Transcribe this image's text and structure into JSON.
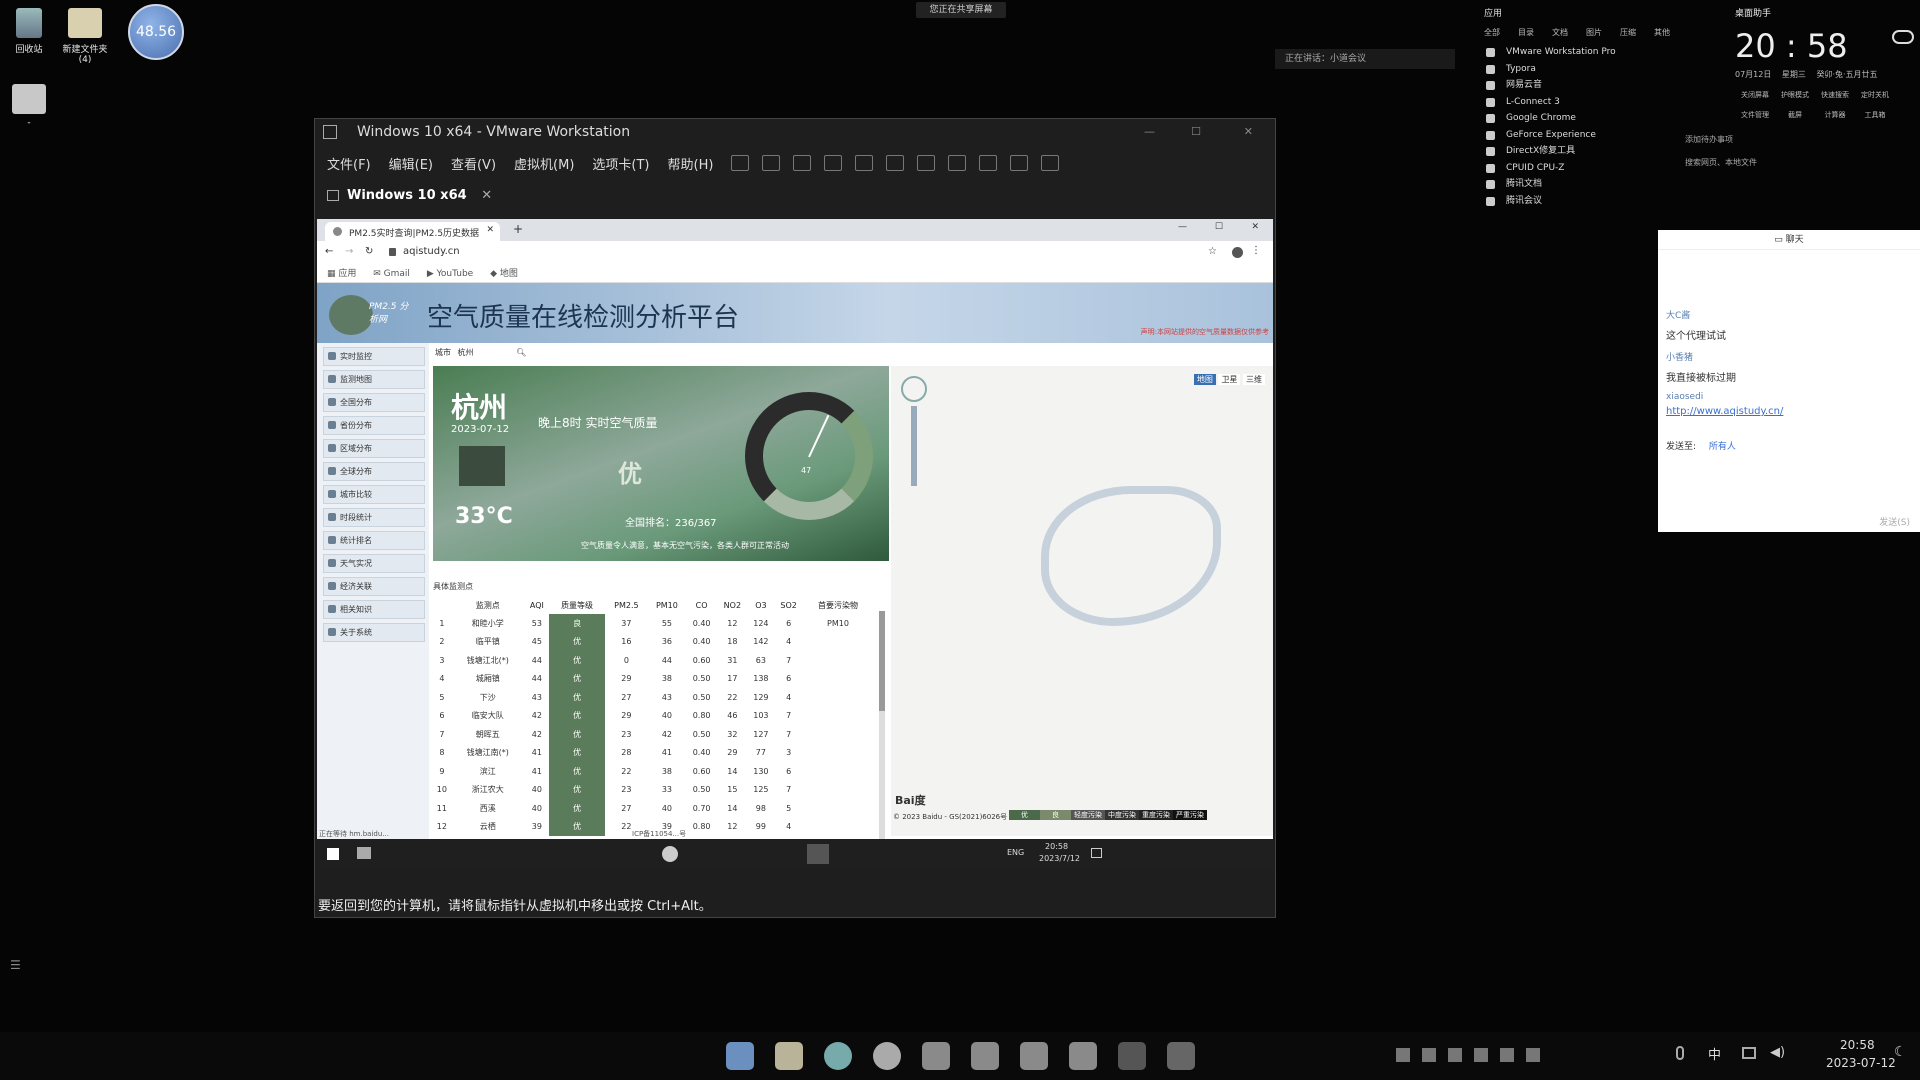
{
  "desktop": {
    "recycle_bin_label": "回收站",
    "new_folder_label": "新建文件夹",
    "new_folder_sub": "(4)",
    "folder2_label": "-",
    "clock_widget_value": "48.56",
    "share_banner": "您正在共享屏幕",
    "speaking_banner": "正在讲话：小道会议"
  },
  "vmware": {
    "title": "Windows 10 x64 - VMware Workstation",
    "menu": [
      "文件(F)",
      "编辑(E)",
      "查看(V)",
      "虚拟机(M)",
      "选项卡(T)",
      "帮助(H)"
    ],
    "tab_label": "Windows 10 x64",
    "status_text": "要返回到您的计算机，请将鼠标指针从虚拟机中移出或按 Ctrl+Alt。"
  },
  "browser": {
    "tab_title": "PM2.5实时查询|PM2.5历史数据",
    "url": "aqistudy.cn",
    "bookmarks": [
      "应用",
      "Gmail",
      "YouTube",
      "地图"
    ]
  },
  "site": {
    "logo_text": "PM2.5 分析网",
    "title": "空气质量在线检测分析平台",
    "header_right": "声明:本网站提供的空气质量数据仅供参考",
    "city_label": "城市",
    "city_value": "杭州",
    "sidebar": [
      "实时监控",
      "监测地图",
      "全国分布",
      "省份分布",
      "区域分布",
      "全球分布",
      "城市比较",
      "时段统计",
      "统计排名",
      "天气实况",
      "经济关联",
      "相关知识",
      "关于系统"
    ],
    "weather": {
      "city": "杭州",
      "date": "2023-07-12",
      "temp": "33°C",
      "heading": "晚上8时 实时空气质量",
      "quality": "优",
      "rank_text": "全国排名：236/367",
      "advice": "空气质量令人满意，基本无空气污染，各类人群可正常活动",
      "gauge_value": "47"
    },
    "table_title": "具体监测点",
    "table_headers": [
      "",
      "监测点",
      "AQI",
      "质量等级",
      "PM2.5",
      "PM10",
      "CO",
      "NO2",
      "O3",
      "SO2",
      "首要污染物"
    ],
    "table_rows": [
      [
        "1",
        "和睦小学",
        "53",
        "良",
        "37",
        "55",
        "0.40",
        "12",
        "124",
        "6",
        "PM10"
      ],
      [
        "2",
        "临平镇",
        "45",
        "优",
        "16",
        "36",
        "0.40",
        "18",
        "142",
        "4",
        ""
      ],
      [
        "3",
        "钱塘江北(*)",
        "44",
        "优",
        "0",
        "44",
        "0.60",
        "31",
        "63",
        "7",
        ""
      ],
      [
        "4",
        "城厢镇",
        "44",
        "优",
        "29",
        "38",
        "0.50",
        "17",
        "138",
        "6",
        ""
      ],
      [
        "5",
        "下沙",
        "43",
        "优",
        "27",
        "43",
        "0.50",
        "22",
        "129",
        "4",
        ""
      ],
      [
        "6",
        "临安大队",
        "42",
        "优",
        "29",
        "40",
        "0.80",
        "46",
        "103",
        "7",
        ""
      ],
      [
        "7",
        "朝晖五",
        "42",
        "优",
        "23",
        "42",
        "0.50",
        "32",
        "127",
        "7",
        ""
      ],
      [
        "8",
        "钱塘江南(*)",
        "41",
        "优",
        "28",
        "41",
        "0.40",
        "29",
        "77",
        "3",
        ""
      ],
      [
        "9",
        "滨江",
        "41",
        "优",
        "22",
        "38",
        "0.60",
        "14",
        "130",
        "6",
        ""
      ],
      [
        "10",
        "浙江农大",
        "40",
        "优",
        "23",
        "33",
        "0.50",
        "15",
        "125",
        "7",
        ""
      ],
      [
        "11",
        "西溪",
        "40",
        "优",
        "27",
        "40",
        "0.70",
        "14",
        "98",
        "5",
        ""
      ],
      [
        "12",
        "云栖",
        "39",
        "优",
        "22",
        "39",
        "0.80",
        "12",
        "99",
        "4",
        ""
      ]
    ],
    "map_buttons": [
      "地图",
      "卫星",
      "三维"
    ],
    "map_copyright": "© 2023 Baidu - GS(2021)6026号",
    "map_legend": [
      "优",
      "良",
      "轻度污染",
      "中度污染",
      "重度污染",
      "严重污染"
    ],
    "footer_left": "正在等待 hm.baidu...",
    "footer_mid": "ICP备11054...号"
  },
  "guest_taskbar": {
    "lang": "ENG",
    "time": "20:58",
    "date": "2023/7/12"
  },
  "start_panel": {
    "title": "应用",
    "tabs": [
      "全部",
      "目录",
      "文档",
      "图片",
      "压缩",
      "其他"
    ],
    "apps": [
      "VMware Workstation Pro",
      "Typora",
      "网易云音",
      "L-Connect 3",
      "Google Chrome",
      "GeForce Experience",
      "DirectX修复工具",
      "CPUID CPU-Z",
      "腾讯文档",
      "腾讯会议"
    ]
  },
  "clock_panel": {
    "title": "桌面助手",
    "time": "20 : 58",
    "date": "07月12日",
    "weekday": "星期三",
    "lunar": "癸卯·兔·五月廿五",
    "shortcuts": [
      "关闭屏幕",
      "护眼模式",
      "快速搜索",
      "定时关机",
      "文件管理",
      "截屏",
      "计算器",
      "工具箱"
    ],
    "add_todo": "添加待办事项",
    "search_hint": "搜索网页、本地文件"
  },
  "chat": {
    "title": "聊天",
    "sender1": "大C酱",
    "msg1": "这个代理试试",
    "sender2": "小香猪",
    "msg2": "我直接被标过期",
    "sender3": "xiaosedi",
    "link": "http://www.aqistudy.cn/",
    "send_to_label": "发送至:",
    "send_to_value": "所有人",
    "send_button": "发送(S)"
  },
  "taskbar": {
    "ime": "中",
    "time": "20:58",
    "date": "2023-07-12"
  }
}
